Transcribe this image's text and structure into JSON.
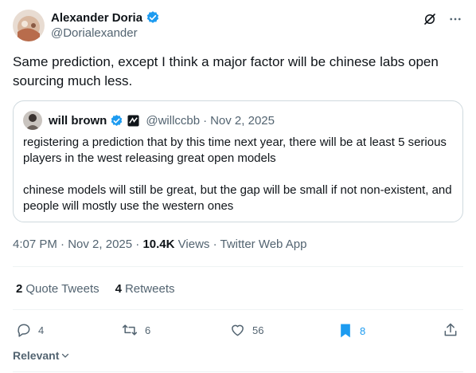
{
  "author": {
    "display_name": "Alexander Doria",
    "handle": "@Dorialexander",
    "verified_color": "#1d9bf0"
  },
  "header_icons": [
    "grok-icon",
    "more-icon"
  ],
  "tweet": {
    "text": "Same prediction, except I think a major factor will be chinese labs open sourcing much less."
  },
  "quoted": {
    "display_name": "will brown",
    "handle": "@willccbb",
    "separator": "·",
    "date": "Nov 2, 2025",
    "paragraphs": [
      "registering a prediction that by this time next year, there will be at least 5 serious players in the west releasing great open models",
      "chinese models will still be great, but the gap will be small if not non-existent, and people will mostly use the western ones"
    ]
  },
  "meta": {
    "time": "4:07 PM",
    "date": "Nov 2, 2025",
    "views_count": "10.4K",
    "views_label": "Views",
    "source": "Twitter Web App"
  },
  "stats": {
    "quote_count": "2",
    "quote_label": "Quote Tweets",
    "retweet_count": "4",
    "retweet_label": "Retweets"
  },
  "actions": {
    "replies": "4",
    "retweets": "6",
    "likes": "56",
    "bookmarks": "8",
    "bookmark_color": "#1d9bf0"
  },
  "sort": {
    "label": "Relevant"
  }
}
